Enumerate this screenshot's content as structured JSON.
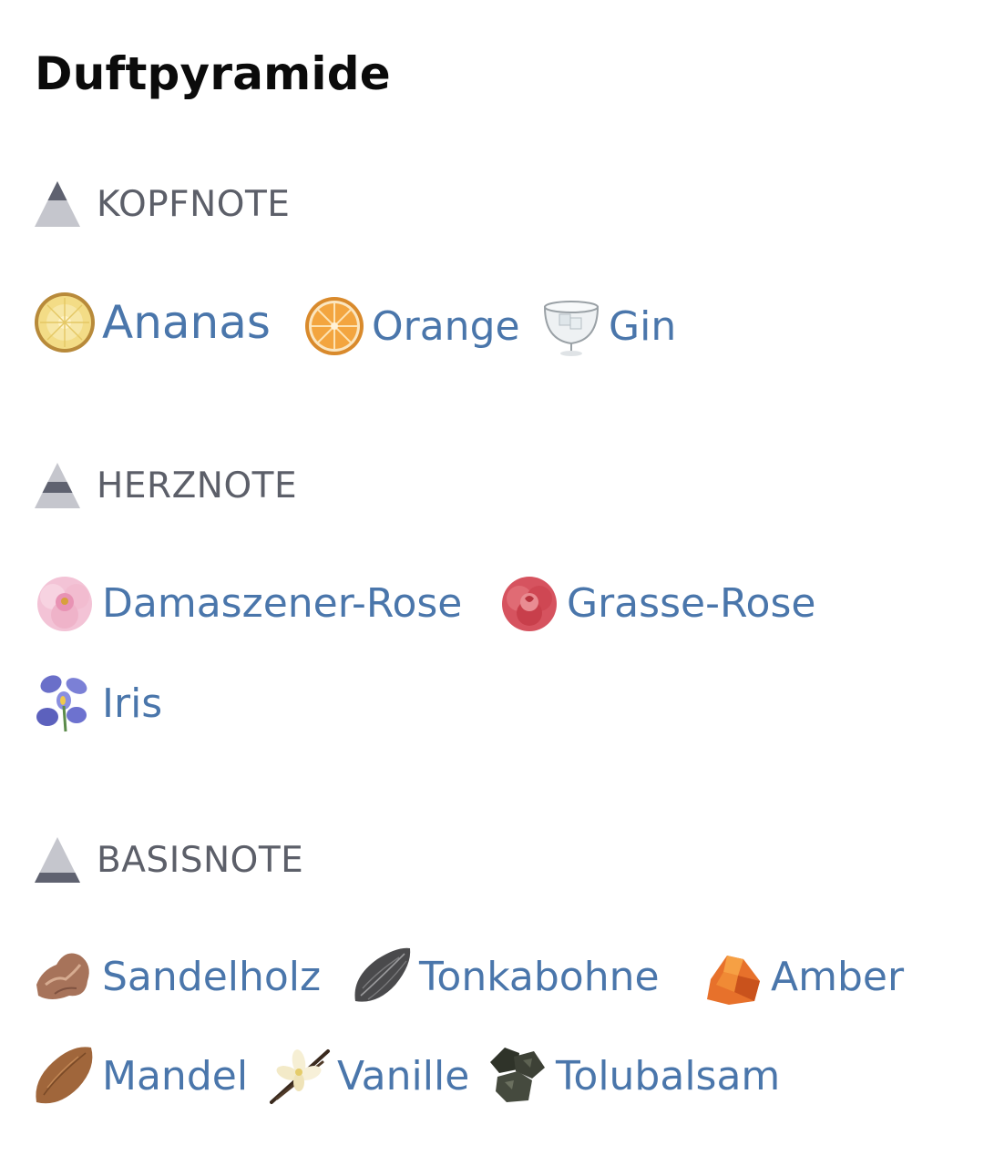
{
  "title": "Duftpyramide",
  "colors": {
    "link": "#4a76ab",
    "section_label": "#5c5f69",
    "pyramid_light": "#c5c6cd",
    "pyramid_dark": "#5f6270"
  },
  "sections": [
    {
      "label": "KOPFNOTE",
      "pyramid_icon": "pyramid-top-icon",
      "notes": [
        {
          "name": "Ananas",
          "icon": "pineapple-icon"
        },
        {
          "name": "Orange",
          "icon": "orange-slice-icon"
        },
        {
          "name": "Gin",
          "icon": "gin-glass-icon"
        }
      ]
    },
    {
      "label": "HERZNOTE",
      "pyramid_icon": "pyramid-middle-icon",
      "notes": [
        {
          "name": "Damaszener-Rose",
          "icon": "pink-rose-icon"
        },
        {
          "name": "Grasse-Rose",
          "icon": "red-rose-icon"
        },
        {
          "name": "Iris",
          "icon": "iris-flower-icon"
        }
      ]
    },
    {
      "label": "BASISNOTE",
      "pyramid_icon": "pyramid-base-icon",
      "notes": [
        {
          "name": "Sandelholz",
          "icon": "sandalwood-icon"
        },
        {
          "name": "Tonkabohne",
          "icon": "tonka-bean-icon"
        },
        {
          "name": "Amber",
          "icon": "amber-icon"
        },
        {
          "name": "Mandel",
          "icon": "almond-icon"
        },
        {
          "name": "Vanille",
          "icon": "vanilla-icon"
        },
        {
          "name": "Tolubalsam",
          "icon": "tolu-balsam-icon"
        }
      ]
    }
  ]
}
